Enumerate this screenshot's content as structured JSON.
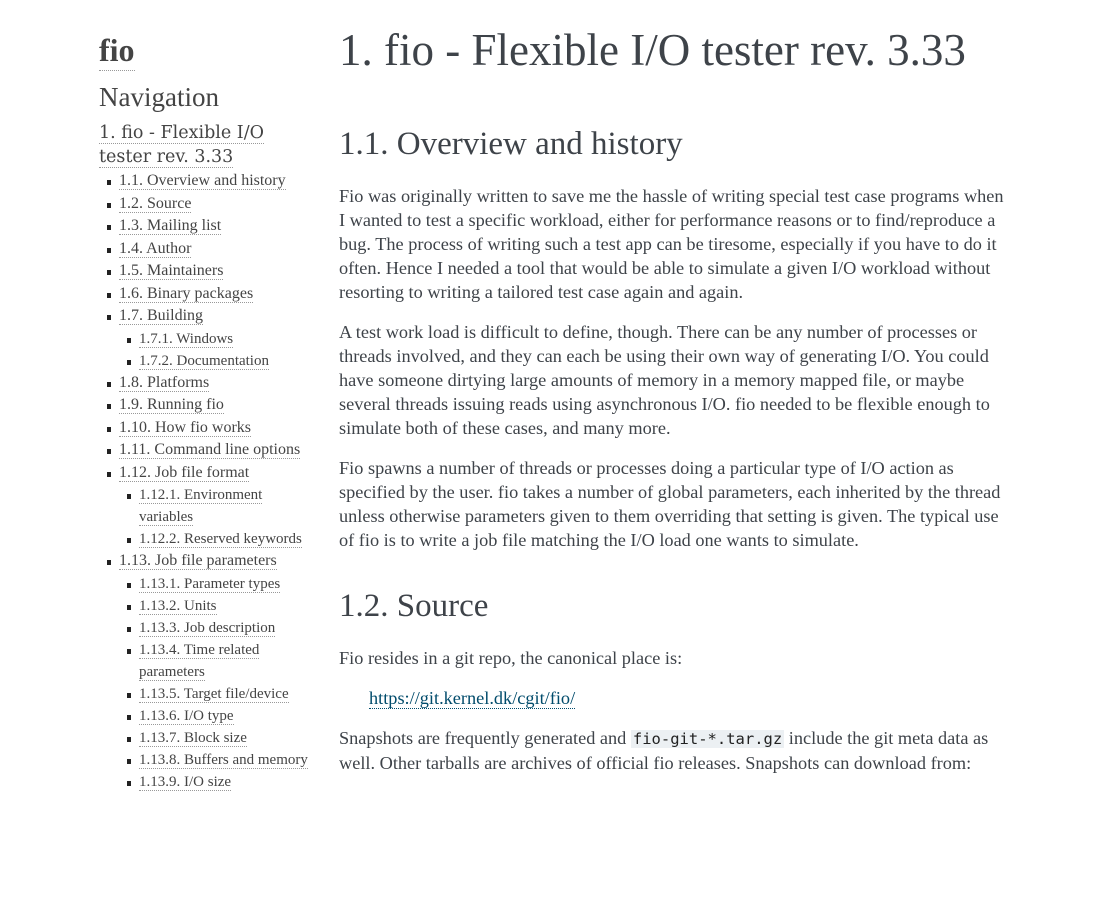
{
  "sidebar": {
    "logo": "fio",
    "nav_title": "Navigation",
    "top_item": "1. fio - Flexible I/O tester rev. 3.33",
    "items": [
      {
        "label": "1.1. Overview and history"
      },
      {
        "label": "1.2. Source"
      },
      {
        "label": "1.3. Mailing list"
      },
      {
        "label": "1.4. Author"
      },
      {
        "label": "1.5. Maintainers"
      },
      {
        "label": "1.6. Binary packages"
      },
      {
        "label": "1.7. Building",
        "children": [
          {
            "label": "1.7.1. Windows"
          },
          {
            "label": "1.7.2. Documentation"
          }
        ]
      },
      {
        "label": "1.8. Platforms"
      },
      {
        "label": "1.9. Running fio"
      },
      {
        "label": "1.10. How fio works"
      },
      {
        "label": "1.11. Command line options"
      },
      {
        "label": "1.12. Job file format",
        "children": [
          {
            "label": "1.12.1. Environment variables"
          },
          {
            "label": "1.12.2. Reserved keywords"
          }
        ]
      },
      {
        "label": "1.13. Job file parameters",
        "children": [
          {
            "label": "1.13.1. Parameter types"
          },
          {
            "label": "1.13.2. Units"
          },
          {
            "label": "1.13.3. Job description"
          },
          {
            "label": "1.13.4. Time related parameters"
          },
          {
            "label": "1.13.5. Target file/device"
          },
          {
            "label": "1.13.6. I/O type"
          },
          {
            "label": "1.13.7. Block size"
          },
          {
            "label": "1.13.8. Buffers and memory"
          },
          {
            "label": "1.13.9. I/O size"
          }
        ]
      }
    ]
  },
  "main": {
    "title": "1. fio - Flexible I/O tester rev. 3.33",
    "sections": {
      "overview": {
        "heading": "1.1. Overview and history",
        "paragraphs": [
          "Fio was originally written to save me the hassle of writing special test case programs when I wanted to test a specific workload, either for performance reasons or to find/reproduce a bug. The process of writing such a test app can be tiresome, especially if you have to do it often. Hence I needed a tool that would be able to simulate a given I/O workload without resorting to writing a tailored test case again and again.",
          "A test work load is difficult to define, though. There can be any number of processes or threads involved, and they can each be using their own way of generating I/O. You could have someone dirtying large amounts of memory in a memory mapped file, or maybe several threads issuing reads using asynchronous I/O. fio needed to be flexible enough to simulate both of these cases, and many more.",
          "Fio spawns a number of threads or processes doing a particular type of I/O action as specified by the user. fio takes a number of global parameters, each inherited by the thread unless otherwise parameters given to them overriding that setting is given. The typical use of fio is to write a job file matching the I/O load one wants to simulate."
        ]
      },
      "source": {
        "heading": "1.2. Source",
        "intro": "Fio resides in a git repo, the canonical place is:",
        "repo_link": "https://git.kernel.dk/cgit/fio/",
        "snap_before": "Snapshots are frequently generated and ",
        "snap_code": "fio-git-*.tar.gz",
        "snap_after": " include the git meta data as well. Other tarballs are archives of official fio releases. Snapshots can download from:"
      }
    }
  }
}
